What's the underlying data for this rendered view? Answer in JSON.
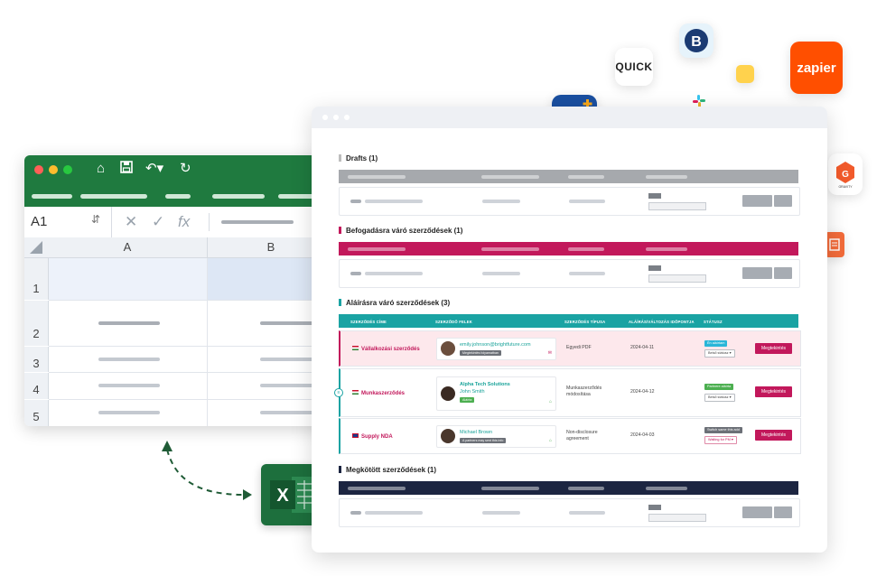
{
  "excel": {
    "cell_ref": "A1",
    "fx_label": "fx",
    "columns": [
      "A",
      "B"
    ],
    "rows": [
      "1",
      "2",
      "3",
      "4",
      "5"
    ],
    "accent": "#1f7a3f"
  },
  "apps": {
    "quick_label": "QUICK",
    "zapier_label": "zapier",
    "zapier_color": "#ff4f00",
    "gravity_label": "GRAVITY",
    "brand_icon": "sq-plus-logo"
  },
  "dashboard": {
    "sections": {
      "drafts": {
        "title": "Drafts (1)",
        "color": "#9e9e9e"
      },
      "pending": {
        "title": "Befogadásra váró szerződések (1)",
        "color": "#c2185b"
      },
      "signing": {
        "title": "Aláírásra váró szerződések (3)",
        "color": "#1aa3a3"
      },
      "signed": {
        "title": "Megkötött szerződések (1)",
        "color": "#1c2541"
      }
    },
    "headers": {
      "title": "SZERZŐDÉS CÍME",
      "parties": "SZERZŐDŐ FELEK",
      "type": "SZERZŐDÉS TÍPUSA",
      "date": "ALÁÍRÁS/VÁLTOZÁS IDŐPONTJA",
      "status": "STÁTUSZ"
    },
    "contracts": [
      {
        "title": "Vállalkozási szerződés",
        "party_name": "emily.johnson@brightfuture.com",
        "party_badge": "Megtekintés folyamatban",
        "type_line1": "Egyedi PDF",
        "type_line2": "",
        "date": "2024-04-11",
        "status_tag": "Én aláírtam",
        "status_select": "Belső státusz",
        "button": "Megtekintés"
      },
      {
        "title": "Munkaszerződés",
        "party_company": "Alpha Tech Solutions",
        "party_name": "John Smith",
        "party_badge": "Aláírta",
        "type_line1": "Munkaszerződés",
        "type_line2": "módosítása",
        "date": "2024-04-12",
        "status_tag": "Partnere aláírta",
        "status_select": "Belső státusz",
        "button": "Megtekintés"
      },
      {
        "title": "Supply NDA",
        "party_name": "Michael Brown",
        "party_badge": "A partners may sent this info",
        "type_line1": "Non-disclosure",
        "type_line2": "agreement",
        "date": "2024-04-03",
        "status_tag": "Switch same this add",
        "status_select": "Waiting for PM",
        "button": "Megtekintés"
      }
    ]
  }
}
